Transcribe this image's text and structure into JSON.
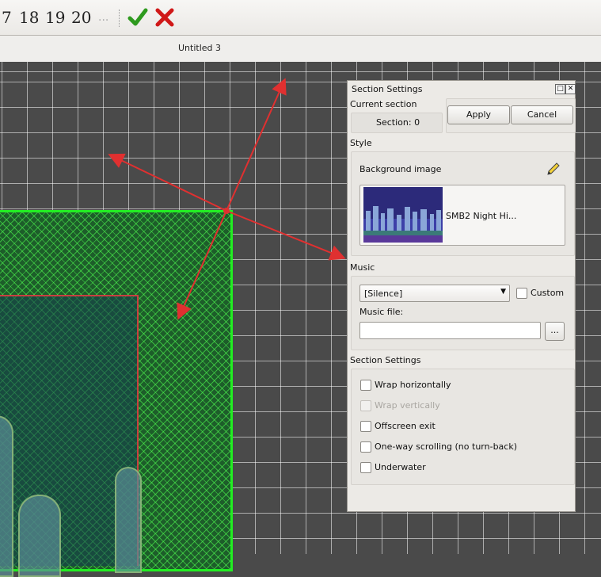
{
  "toolbar": {
    "page_numbers": [
      "7",
      "18",
      "19",
      "20"
    ],
    "more_label": "...",
    "confirm_icon": "checkmark-icon",
    "cancel_icon": "cross-icon"
  },
  "tab": {
    "title": "Untitled 3"
  },
  "dialog": {
    "title": "Section Settings",
    "current_section_label": "Current section",
    "section_display": "Section:  0",
    "apply_label": "Apply",
    "cancel_label": "Cancel",
    "style_label": "Style",
    "background_image_label": "Background image",
    "background_name": "SMB2 Night Hi...",
    "music_label": "Music",
    "music_selected": "[Silence]",
    "custom_label": "Custom",
    "music_file_label": "Music file:",
    "music_file_value": "",
    "browse_label": "...",
    "section_settings_label": "Section Settings",
    "options": [
      {
        "label": "Wrap horizontally",
        "checked": false,
        "enabled": true
      },
      {
        "label": "Wrap vertically",
        "checked": false,
        "enabled": false
      },
      {
        "label": "Offscreen exit",
        "checked": false,
        "enabled": true
      },
      {
        "label": "One-way scrolling (no turn-back)",
        "checked": false,
        "enabled": true
      },
      {
        "label": "Underwater",
        "checked": false,
        "enabled": true
      }
    ]
  },
  "colors": {
    "section_border": "#22ee22",
    "arrow": "#e03030",
    "confirm": "#2e9a1e",
    "cancel": "#d01818"
  }
}
